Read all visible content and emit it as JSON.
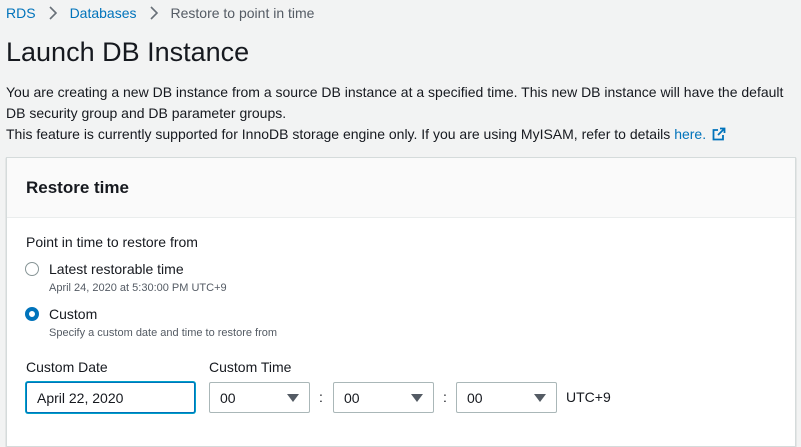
{
  "breadcrumb": {
    "items": [
      {
        "label": "RDS"
      },
      {
        "label": "Databases"
      },
      {
        "label": "Restore to point in time"
      }
    ]
  },
  "page": {
    "title": "Launch DB Instance",
    "description_line1": "You are creating a new DB instance from a source DB instance at a specified time. This new DB instance will have the default DB security group and DB parameter groups.",
    "description_line2": "This feature is currently supported for InnoDB storage engine only. If you are using MyISAM, refer to details",
    "details_link": "here."
  },
  "panel": {
    "title": "Restore time",
    "field_label": "Point in time to restore from",
    "options": [
      {
        "label": "Latest restorable time",
        "sub": "April 24, 2020 at 5:30:00 PM UTC+9",
        "checked": false
      },
      {
        "label": "Custom",
        "sub": "Specify a custom date and time to restore from",
        "checked": true
      }
    ],
    "custom_date_label": "Custom Date",
    "custom_date_value": "April 22, 2020",
    "custom_time_label": "Custom Time",
    "hour": "00",
    "minute": "00",
    "second": "00",
    "separator": ":",
    "timezone": "UTC+9"
  },
  "colors": {
    "link": "#0073bb",
    "focus": "#00a1c9",
    "background": "#f2f3f3"
  }
}
